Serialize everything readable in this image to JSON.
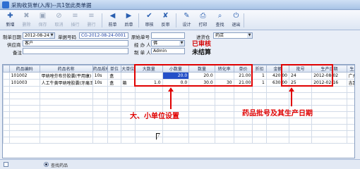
{
  "window": {
    "title": "采购收货单(入库)--共1张此类单据"
  },
  "toolbar": [
    {
      "label": "新增",
      "icon": "new-icon",
      "glyph": "✚",
      "disabled": false
    },
    {
      "label": "删除",
      "icon": "delete-icon",
      "glyph": "✖",
      "disabled": true
    },
    {
      "label": "保存",
      "icon": "save-icon",
      "glyph": "▣",
      "disabled": true
    },
    {
      "label": "取消",
      "icon": "cancel-icon",
      "glyph": "⊘",
      "disabled": true
    },
    {
      "label": "插行",
      "icon": "insert-row-icon",
      "glyph": "≡",
      "disabled": true
    },
    {
      "label": "删行",
      "icon": "delete-row-icon",
      "glyph": "≡",
      "disabled": true
    },
    {
      "label": "前单",
      "icon": "prev-icon",
      "glyph": "◀",
      "disabled": false
    },
    {
      "label": "后单",
      "icon": "next-icon",
      "glyph": "▶",
      "disabled": false
    },
    {
      "label": "审核",
      "icon": "approve-icon",
      "glyph": "✔",
      "disabled": false
    },
    {
      "label": "反审",
      "icon": "unapprove-icon",
      "glyph": "✘",
      "disabled": false
    },
    {
      "label": "设计",
      "icon": "design-icon",
      "glyph": "✎",
      "disabled": false
    },
    {
      "label": "打印",
      "icon": "print-icon",
      "glyph": "⎙",
      "disabled": false
    },
    {
      "label": "查找",
      "icon": "find-icon",
      "glyph": "⌕",
      "disabled": false
    },
    {
      "label": "退出",
      "icon": "exit-icon",
      "glyph": "⏻",
      "disabled": false
    }
  ],
  "form": {
    "date_label": "制单日期",
    "date_value": "2012-08-24",
    "docno_label": "单据号码",
    "docno_value": "CG-2012-08-24-0001",
    "orig_label": "原始单号",
    "orig_value": "",
    "warehouse_label": "进货仓",
    "warehouse_value": "药店",
    "supplier_label": "供应商",
    "supplier_value": "客户",
    "handler_label": "经 办 人",
    "handler_value": "佛",
    "maker_label": "制 单 人",
    "maker_value": "Admin",
    "remark_label": "备注",
    "remark_value": "",
    "approved_status": "已审核",
    "settle_status": "未结算"
  },
  "table": {
    "columns": [
      "药品编码",
      "药品名称",
      "药品规格",
      "单位",
      "大单位",
      "大数量",
      "小数量",
      "数量",
      "转化率",
      "单价",
      "折扣",
      "金额",
      "批号",
      "生产日期",
      "生产企业"
    ],
    "rows": [
      [
        "101002",
        "甲硝唑芬布芬胶囊(平用康)",
        "10s",
        "盒",
        "",
        "",
        "20.0",
        "20.0",
        "",
        "21.00",
        "1",
        "420.00",
        "24",
        "2012-08-02",
        "广州欧"
      ],
      [
        "101003",
        "人工牛黄甲硝唑胶囊(牙痛王)",
        "10s",
        "盒",
        "箱",
        "1.0",
        "0.0",
        "30.0",
        "30",
        "21.00",
        "1",
        "630.00",
        "25",
        "2012-02-16",
        "吉富庄"
      ]
    ]
  },
  "annotations": {
    "unit_setup": "大、小单位设置",
    "batch_info": "药品批号及其生产日期"
  },
  "bottom": {
    "checkbox_label": "",
    "option_label": "查找药品"
  },
  "colors": {
    "highlight": "#e00000",
    "approved": "#d60000",
    "selection": "#2450c8"
  }
}
